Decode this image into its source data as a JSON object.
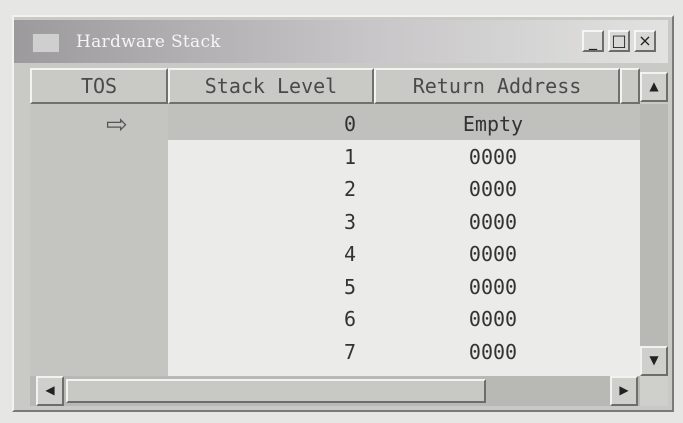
{
  "window": {
    "title": "Hardware Stack",
    "minimize_label": "_",
    "maximize_label": "□",
    "close_label": "×"
  },
  "columns": {
    "tos": "TOS",
    "stack_level": "Stack Level",
    "return_address": "Return Address"
  },
  "tos_marker_row": 0,
  "rows": [
    {
      "level": "0",
      "address": "Empty"
    },
    {
      "level": "1",
      "address": "0000"
    },
    {
      "level": "2",
      "address": "0000"
    },
    {
      "level": "3",
      "address": "0000"
    },
    {
      "level": "4",
      "address": "0000"
    },
    {
      "level": "5",
      "address": "0000"
    },
    {
      "level": "6",
      "address": "0000"
    },
    {
      "level": "7",
      "address": "0000"
    }
  ],
  "icons": {
    "tos_marker": "right-arrow-icon",
    "scroll_up": "up-arrow-icon",
    "scroll_down": "down-arrow-icon",
    "scroll_left": "left-arrow-icon",
    "scroll_right": "right-arrow-icon"
  }
}
